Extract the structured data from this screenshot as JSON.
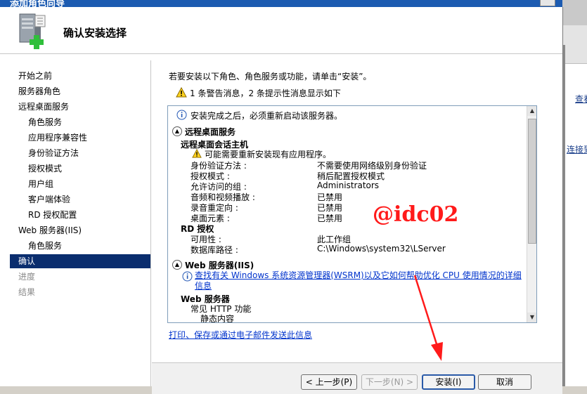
{
  "window": {
    "title": "添加角色向导"
  },
  "header": {
    "title": "确认安装选择"
  },
  "nav": {
    "items": [
      {
        "label": "开始之前",
        "level": 0,
        "state": "normal"
      },
      {
        "label": "服务器角色",
        "level": 0,
        "state": "normal"
      },
      {
        "label": "远程桌面服务",
        "level": 0,
        "state": "normal"
      },
      {
        "label": "角色服务",
        "level": 1,
        "state": "normal"
      },
      {
        "label": "应用程序兼容性",
        "level": 1,
        "state": "normal"
      },
      {
        "label": "身份验证方法",
        "level": 1,
        "state": "normal"
      },
      {
        "label": "授权模式",
        "level": 1,
        "state": "normal"
      },
      {
        "label": "用户组",
        "level": 1,
        "state": "normal"
      },
      {
        "label": "客户端体验",
        "level": 1,
        "state": "normal"
      },
      {
        "label": "RD 授权配置",
        "level": 1,
        "state": "normal"
      },
      {
        "label": "Web 服务器(IIS)",
        "level": 0,
        "state": "normal"
      },
      {
        "label": "角色服务",
        "level": 1,
        "state": "normal"
      },
      {
        "label": "确认",
        "level": 0,
        "state": "selected"
      },
      {
        "label": "进度",
        "level": 0,
        "state": "disabled"
      },
      {
        "label": "结果",
        "level": 0,
        "state": "disabled"
      }
    ]
  },
  "content": {
    "intro": "若要安装以下角色、角色服务或功能，请单击“安装”。",
    "warning_summary": "1 条警告消息，2 条提示性消息显示如下",
    "summary": {
      "info_restart": "安装完成之后，必须重新启动该服务器。",
      "section_rds": "远程桌面服务",
      "rdsh_title": "远程桌面会话主机",
      "rdsh_warning": "可能需要重新安装现有应用程序。",
      "rdsh_rows": [
        {
          "key": "身份验证方法 :",
          "value": "不需要使用网络级别身份验证"
        },
        {
          "key": "授权模式 :",
          "value": "稍后配置授权模式"
        },
        {
          "key": "允许访问的组 :",
          "value": "Administrators"
        },
        {
          "key": "音频和视频播放 :",
          "value": "已禁用"
        },
        {
          "key": "录音重定向 :",
          "value": "已禁用"
        },
        {
          "key": "桌面元素 :",
          "value": "已禁用"
        }
      ],
      "rdl_title": "RD 授权",
      "rdl_rows": [
        {
          "key": "可用性 :",
          "value": "此工作组"
        },
        {
          "key": "数据库路径 :",
          "value": "C:\\Windows\\system32\\LServer"
        }
      ],
      "section_iis": "Web 服务器(IIS)",
      "iis_info_link": "查找有关 Windows 系统资源管理器(WSRM)以及它如何帮助优化 CPU 使用情况的详细信息",
      "iis_web_title": "Web 服务器",
      "iis_common": "常见 HTTP 功能",
      "iis_static": "静态内容"
    },
    "print_link": "打印、保存或通过电子邮件发送此信息"
  },
  "footer": {
    "prev": "< 上一步(P)",
    "next": "下一步(N) >",
    "install": "安装(I)",
    "cancel": "取消"
  },
  "background": {
    "text1": "查看",
    "text2": "连接到"
  },
  "watermark": "@idc02",
  "colors": {
    "selected_nav": "#0a2d6e",
    "link": "#0033cc",
    "watermark": "#ff1a1a",
    "titlebar": "#1c5bb1"
  }
}
